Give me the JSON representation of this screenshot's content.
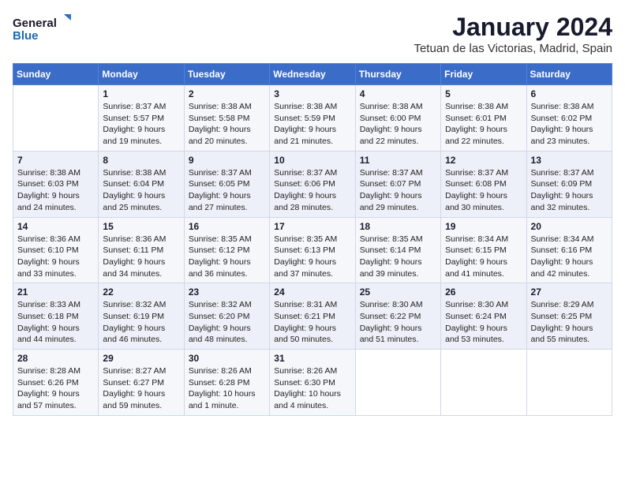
{
  "logo": {
    "line1": "General",
    "line2": "Blue"
  },
  "title": "January 2024",
  "subtitle": "Tetuan de las Victorias, Madrid, Spain",
  "days_of_week": [
    "Sunday",
    "Monday",
    "Tuesday",
    "Wednesday",
    "Thursday",
    "Friday",
    "Saturday"
  ],
  "weeks": [
    [
      {
        "day": "",
        "info": ""
      },
      {
        "day": "1",
        "info": "Sunrise: 8:37 AM\nSunset: 5:57 PM\nDaylight: 9 hours\nand 19 minutes."
      },
      {
        "day": "2",
        "info": "Sunrise: 8:38 AM\nSunset: 5:58 PM\nDaylight: 9 hours\nand 20 minutes."
      },
      {
        "day": "3",
        "info": "Sunrise: 8:38 AM\nSunset: 5:59 PM\nDaylight: 9 hours\nand 21 minutes."
      },
      {
        "day": "4",
        "info": "Sunrise: 8:38 AM\nSunset: 6:00 PM\nDaylight: 9 hours\nand 22 minutes."
      },
      {
        "day": "5",
        "info": "Sunrise: 8:38 AM\nSunset: 6:01 PM\nDaylight: 9 hours\nand 22 minutes."
      },
      {
        "day": "6",
        "info": "Sunrise: 8:38 AM\nSunset: 6:02 PM\nDaylight: 9 hours\nand 23 minutes."
      }
    ],
    [
      {
        "day": "7",
        "info": "Sunrise: 8:38 AM\nSunset: 6:03 PM\nDaylight: 9 hours\nand 24 minutes."
      },
      {
        "day": "8",
        "info": "Sunrise: 8:38 AM\nSunset: 6:04 PM\nDaylight: 9 hours\nand 25 minutes."
      },
      {
        "day": "9",
        "info": "Sunrise: 8:37 AM\nSunset: 6:05 PM\nDaylight: 9 hours\nand 27 minutes."
      },
      {
        "day": "10",
        "info": "Sunrise: 8:37 AM\nSunset: 6:06 PM\nDaylight: 9 hours\nand 28 minutes."
      },
      {
        "day": "11",
        "info": "Sunrise: 8:37 AM\nSunset: 6:07 PM\nDaylight: 9 hours\nand 29 minutes."
      },
      {
        "day": "12",
        "info": "Sunrise: 8:37 AM\nSunset: 6:08 PM\nDaylight: 9 hours\nand 30 minutes."
      },
      {
        "day": "13",
        "info": "Sunrise: 8:37 AM\nSunset: 6:09 PM\nDaylight: 9 hours\nand 32 minutes."
      }
    ],
    [
      {
        "day": "14",
        "info": "Sunrise: 8:36 AM\nSunset: 6:10 PM\nDaylight: 9 hours\nand 33 minutes."
      },
      {
        "day": "15",
        "info": "Sunrise: 8:36 AM\nSunset: 6:11 PM\nDaylight: 9 hours\nand 34 minutes."
      },
      {
        "day": "16",
        "info": "Sunrise: 8:35 AM\nSunset: 6:12 PM\nDaylight: 9 hours\nand 36 minutes."
      },
      {
        "day": "17",
        "info": "Sunrise: 8:35 AM\nSunset: 6:13 PM\nDaylight: 9 hours\nand 37 minutes."
      },
      {
        "day": "18",
        "info": "Sunrise: 8:35 AM\nSunset: 6:14 PM\nDaylight: 9 hours\nand 39 minutes."
      },
      {
        "day": "19",
        "info": "Sunrise: 8:34 AM\nSunset: 6:15 PM\nDaylight: 9 hours\nand 41 minutes."
      },
      {
        "day": "20",
        "info": "Sunrise: 8:34 AM\nSunset: 6:16 PM\nDaylight: 9 hours\nand 42 minutes."
      }
    ],
    [
      {
        "day": "21",
        "info": "Sunrise: 8:33 AM\nSunset: 6:18 PM\nDaylight: 9 hours\nand 44 minutes."
      },
      {
        "day": "22",
        "info": "Sunrise: 8:32 AM\nSunset: 6:19 PM\nDaylight: 9 hours\nand 46 minutes."
      },
      {
        "day": "23",
        "info": "Sunrise: 8:32 AM\nSunset: 6:20 PM\nDaylight: 9 hours\nand 48 minutes."
      },
      {
        "day": "24",
        "info": "Sunrise: 8:31 AM\nSunset: 6:21 PM\nDaylight: 9 hours\nand 50 minutes."
      },
      {
        "day": "25",
        "info": "Sunrise: 8:30 AM\nSunset: 6:22 PM\nDaylight: 9 hours\nand 51 minutes."
      },
      {
        "day": "26",
        "info": "Sunrise: 8:30 AM\nSunset: 6:24 PM\nDaylight: 9 hours\nand 53 minutes."
      },
      {
        "day": "27",
        "info": "Sunrise: 8:29 AM\nSunset: 6:25 PM\nDaylight: 9 hours\nand 55 minutes."
      }
    ],
    [
      {
        "day": "28",
        "info": "Sunrise: 8:28 AM\nSunset: 6:26 PM\nDaylight: 9 hours\nand 57 minutes."
      },
      {
        "day": "29",
        "info": "Sunrise: 8:27 AM\nSunset: 6:27 PM\nDaylight: 9 hours\nand 59 minutes."
      },
      {
        "day": "30",
        "info": "Sunrise: 8:26 AM\nSunset: 6:28 PM\nDaylight: 10 hours\nand 1 minute."
      },
      {
        "day": "31",
        "info": "Sunrise: 8:26 AM\nSunset: 6:30 PM\nDaylight: 10 hours\nand 4 minutes."
      },
      {
        "day": "",
        "info": ""
      },
      {
        "day": "",
        "info": ""
      },
      {
        "day": "",
        "info": ""
      }
    ]
  ]
}
